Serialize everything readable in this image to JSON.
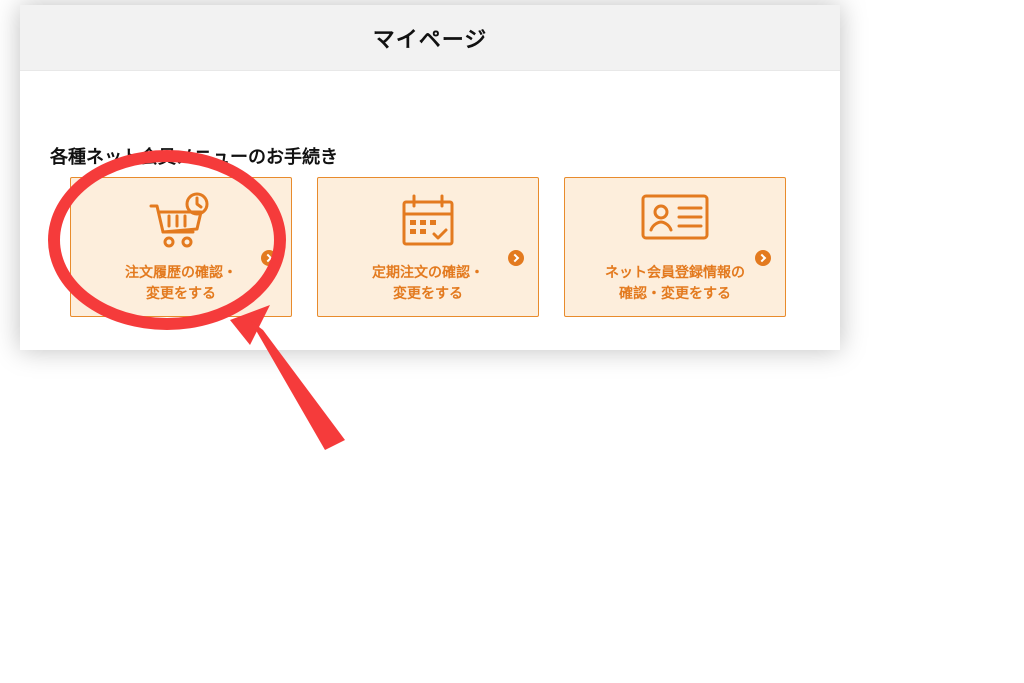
{
  "header": {
    "title": "マイページ"
  },
  "section": {
    "title": "各種ネット会員メニューのお手続き"
  },
  "cards": [
    {
      "label": "注文履歴の確認・\n変更をする"
    },
    {
      "label": "定期注文の確認・\n変更をする"
    },
    {
      "label": "ネット会員登録情報の\n確認・変更をする"
    }
  ],
  "accent": "#e37a1f",
  "annotation_color": "#f53b3b"
}
